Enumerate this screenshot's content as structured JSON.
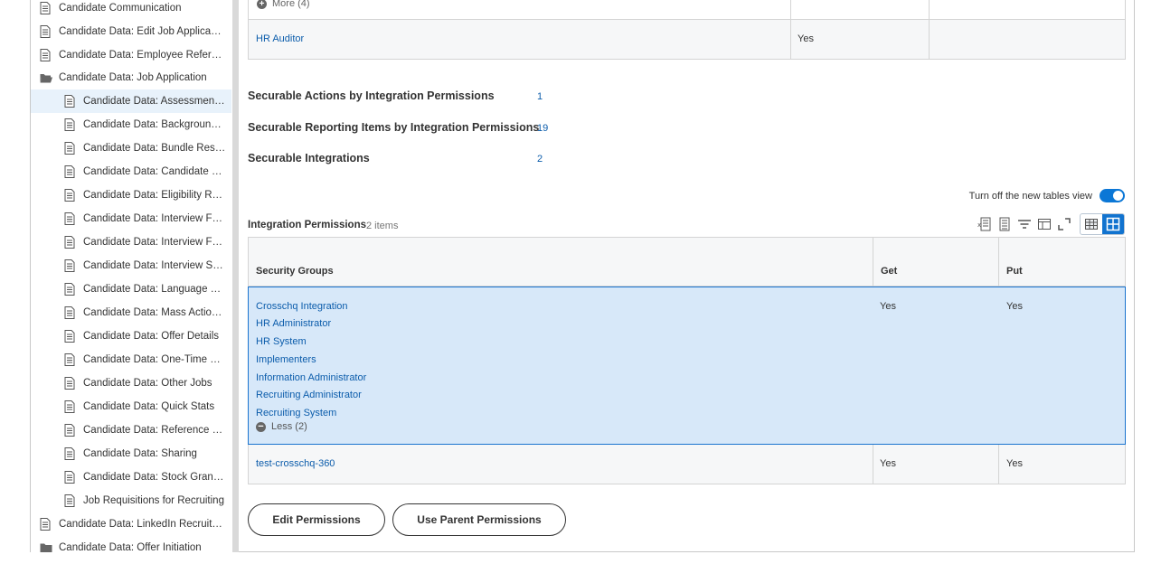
{
  "sidebar": {
    "items": [
      {
        "label": "Candidate Communication",
        "level": 0,
        "icon": "document-icon"
      },
      {
        "label": "Candidate Data: Edit Job Application",
        "level": 0,
        "icon": "document-icon"
      },
      {
        "label": "Candidate Data: Employee Referrals",
        "level": 0,
        "icon": "document-icon"
      },
      {
        "label": "Candidate Data: Job Application",
        "level": 0,
        "icon": "folder-open-icon"
      },
      {
        "label": "Candidate Data: Assessment R...",
        "level": 1,
        "icon": "document-icon",
        "selected": true
      },
      {
        "label": "Candidate Data: Background C...",
        "level": 1,
        "icon": "document-icon"
      },
      {
        "label": "Candidate Data: Bundle Resum...",
        "level": 1,
        "icon": "document-icon"
      },
      {
        "label": "Candidate Data: Candidate Exp...",
        "level": 1,
        "icon": "document-icon"
      },
      {
        "label": "Candidate Data: Eligibility Resu...",
        "level": 1,
        "icon": "document-icon"
      },
      {
        "label": "Candidate Data: Interview Feed...",
        "level": 1,
        "icon": "document-icon"
      },
      {
        "label": "Candidate Data: Interview Feed...",
        "level": 1,
        "icon": "document-icon"
      },
      {
        "label": "Candidate Data: Interview Sche...",
        "level": 1,
        "icon": "document-icon"
      },
      {
        "label": "Candidate Data: Language Skills",
        "level": 1,
        "icon": "document-icon"
      },
      {
        "label": "Candidate Data: Mass Actions ...",
        "level": 1,
        "icon": "document-icon"
      },
      {
        "label": "Candidate Data: Offer Details",
        "level": 1,
        "icon": "document-icon"
      },
      {
        "label": "Candidate Data: One-Time Pay...",
        "level": 1,
        "icon": "document-icon"
      },
      {
        "label": "Candidate Data: Other Jobs",
        "level": 1,
        "icon": "document-icon"
      },
      {
        "label": "Candidate Data: Quick Stats",
        "level": 1,
        "icon": "document-icon"
      },
      {
        "label": "Candidate Data: Reference Che...",
        "level": 1,
        "icon": "document-icon"
      },
      {
        "label": "Candidate Data: Sharing",
        "level": 1,
        "icon": "document-icon"
      },
      {
        "label": "Candidate Data: Stock Grant Of...",
        "level": 1,
        "icon": "document-icon"
      },
      {
        "label": "Job Requisitions for Recruiting",
        "level": 1,
        "icon": "document-icon"
      },
      {
        "label": "Candidate Data: LinkedIn Recruiter S...",
        "level": 0,
        "icon": "document-icon"
      },
      {
        "label": "Candidate Data: Offer Initiation",
        "level": 0,
        "icon": "folder-icon"
      }
    ]
  },
  "top_table": {
    "more_label": "More (4)",
    "row": {
      "group": "HR Auditor",
      "value": "Yes"
    }
  },
  "stats": [
    {
      "label": "Securable Actions by Integration Permissions",
      "value": "1"
    },
    {
      "label": "Securable Reporting Items by Integration Permissions",
      "value": "19"
    },
    {
      "label": "Securable Integrations",
      "value": "2"
    }
  ],
  "table_view_toggle": {
    "label": "Turn off the new tables view",
    "on": true
  },
  "integration_permissions": {
    "title": "Integration Permissions",
    "count": "2 items",
    "columns": [
      "Security Groups",
      "Get",
      "Put"
    ],
    "rows": [
      {
        "groups": [
          "Crosschq Integration",
          "HR Administrator",
          "HR System",
          "Implementers",
          "Information Administrator",
          "Recruiting Administrator",
          "Recruiting System"
        ],
        "less_label": "Less (2)",
        "get": "Yes",
        "put": "Yes"
      },
      {
        "groups": [
          "test-crosschq-360"
        ],
        "get": "Yes",
        "put": "Yes"
      }
    ]
  },
  "buttons": {
    "edit": "Edit Permissions",
    "parent": "Use Parent Permissions"
  },
  "colors": {
    "link": "#0b5cab",
    "accent": "#1173cf",
    "selection": "#d7e8f9"
  }
}
